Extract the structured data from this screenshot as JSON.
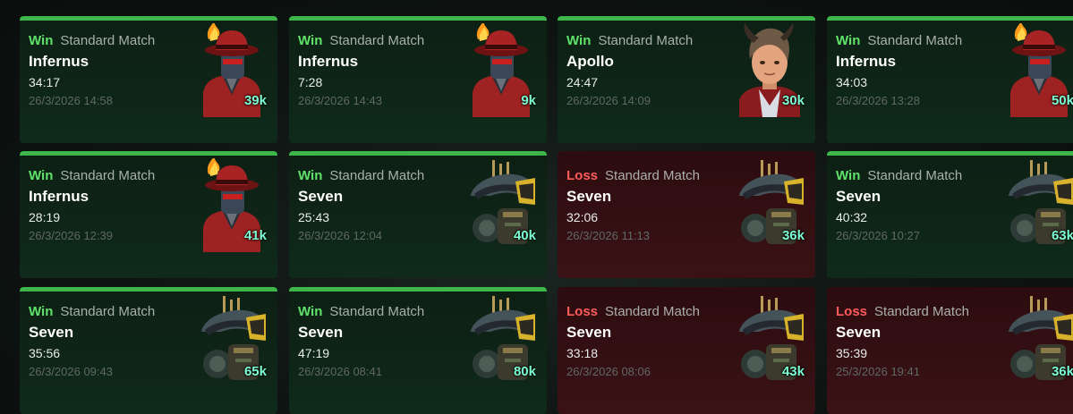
{
  "colors": {
    "win_bar": "#3fb64a",
    "win_text": "#5fe36a",
    "loss_text": "#ff5a5a",
    "souls_text": "#7dffd4"
  },
  "matches": [
    {
      "result": "Win",
      "mode": "Standard Match",
      "hero": "Infernus",
      "duration": "34:17",
      "datetime": "26/3/2026 14:58",
      "souls": "39k",
      "portrait_icon": "infernus-portrait-icon"
    },
    {
      "result": "Win",
      "mode": "Standard Match",
      "hero": "Infernus",
      "duration": "7:28",
      "datetime": "26/3/2026 14:43",
      "souls": "9k",
      "portrait_icon": "infernus-portrait-icon"
    },
    {
      "result": "Win",
      "mode": "Standard Match",
      "hero": "Apollo",
      "duration": "24:47",
      "datetime": "26/3/2026 14:09",
      "souls": "30k",
      "portrait_icon": "apollo-portrait-icon"
    },
    {
      "result": "Win",
      "mode": "Standard Match",
      "hero": "Infernus",
      "duration": "34:03",
      "datetime": "26/3/2026 13:28",
      "souls": "50k",
      "portrait_icon": "infernus-portrait-icon"
    },
    {
      "result": "Win",
      "mode": "Standard Match",
      "hero": "Infernus",
      "duration": "28:19",
      "datetime": "26/3/2026 12:39",
      "souls": "41k",
      "portrait_icon": "infernus-portrait-icon"
    },
    {
      "result": "Win",
      "mode": "Standard Match",
      "hero": "Seven",
      "duration": "25:43",
      "datetime": "26/3/2026 12:04",
      "souls": "40k",
      "portrait_icon": "seven-portrait-icon"
    },
    {
      "result": "Loss",
      "mode": "Standard Match",
      "hero": "Seven",
      "duration": "32:06",
      "datetime": "26/3/2026 11:13",
      "souls": "36k",
      "portrait_icon": "seven-portrait-icon"
    },
    {
      "result": "Win",
      "mode": "Standard Match",
      "hero": "Seven",
      "duration": "40:32",
      "datetime": "26/3/2026 10:27",
      "souls": "63k",
      "portrait_icon": "seven-portrait-icon"
    },
    {
      "result": "Win",
      "mode": "Standard Match",
      "hero": "Seven",
      "duration": "35:56",
      "datetime": "26/3/2026 09:43",
      "souls": "65k",
      "portrait_icon": "seven-portrait-icon"
    },
    {
      "result": "Win",
      "mode": "Standard Match",
      "hero": "Seven",
      "duration": "47:19",
      "datetime": "26/3/2026 08:41",
      "souls": "80k",
      "portrait_icon": "seven-portrait-icon"
    },
    {
      "result": "Loss",
      "mode": "Standard Match",
      "hero": "Seven",
      "duration": "33:18",
      "datetime": "26/3/2026 08:06",
      "souls": "43k",
      "portrait_icon": "seven-portrait-icon"
    },
    {
      "result": "Loss",
      "mode": "Standard Match",
      "hero": "Seven",
      "duration": "35:39",
      "datetime": "25/3/2026 19:41",
      "souls": "36k",
      "portrait_icon": "seven-portrait-icon"
    }
  ]
}
